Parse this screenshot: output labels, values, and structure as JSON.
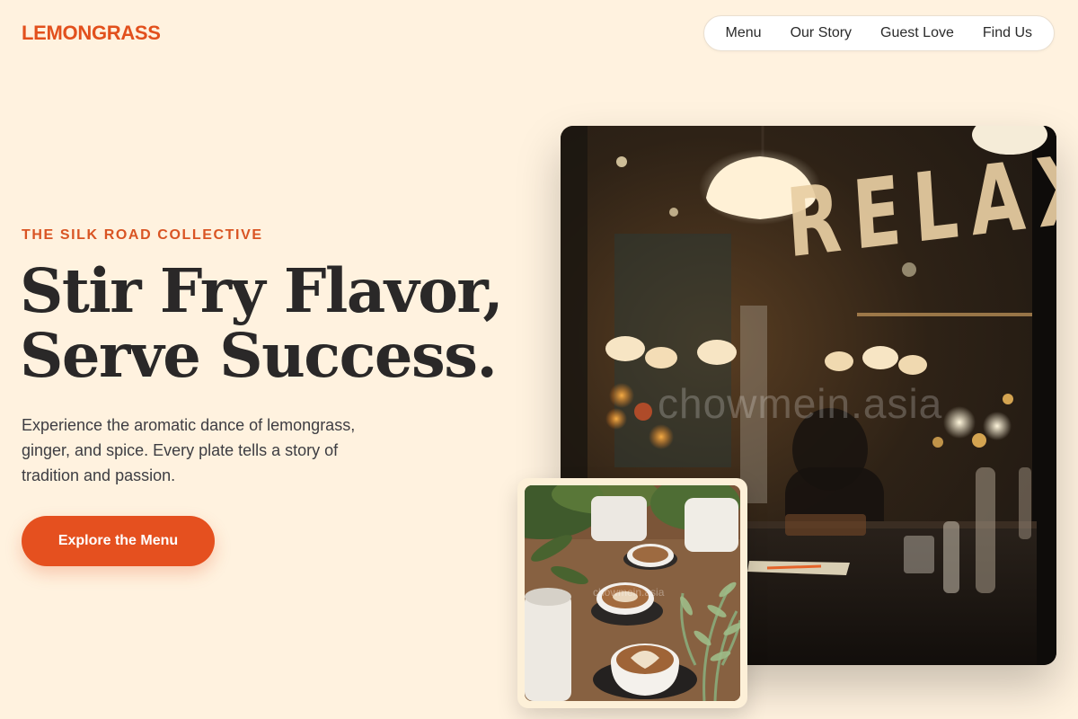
{
  "brand": {
    "name": "LEMONGRASS",
    "accent": "#e2501d",
    "background": "#fff2df"
  },
  "nav": {
    "items": [
      {
        "label": "Menu"
      },
      {
        "label": "Our Story"
      },
      {
        "label": "Guest Love"
      },
      {
        "label": "Find Us"
      }
    ]
  },
  "hero": {
    "eyebrow": "THE SILK ROAD COLLECTIVE",
    "headline_line1": "Stir Fry Flavor,",
    "headline_line2": "Serve Success.",
    "lead": "Experience the aromatic dance of lemongrass, ginger, and spice. Every plate tells a story of tradition and passion.",
    "cta_label": "Explore the Menu"
  },
  "images": {
    "main": {
      "sign_text": "RELAX",
      "watermark": "chowmein.asia"
    },
    "secondary": {
      "watermark": "chowmein.asia"
    }
  }
}
